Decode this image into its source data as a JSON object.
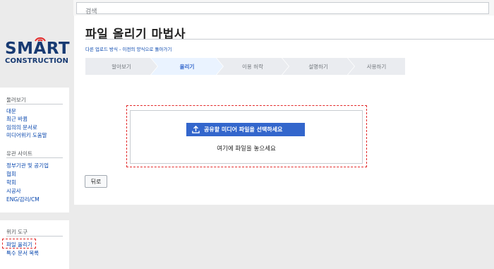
{
  "search": {
    "placeholder": "검색"
  },
  "logo": {
    "line1": "SMART",
    "line2": "CONSTRUCTION"
  },
  "sidebar": {
    "browse": {
      "heading": "둘러보기",
      "items": [
        "대문",
        "최근 바뀜",
        "임의의 문서로",
        "미디어위키 도움말"
      ]
    },
    "related": {
      "heading": "유관 사이트",
      "items": [
        "정부기관 및 공기업",
        "협회",
        "학회",
        "시공사",
        "ENG/감리/CM"
      ]
    },
    "tools": {
      "heading": "위키 도구",
      "items": [
        "파일 올리기",
        "특수 문서 목록"
      ]
    }
  },
  "page": {
    "title": "파일 올리기 마법사",
    "alt_link": "다른 업로드 방식 - 이전의 양식으로 돌아가기"
  },
  "steps": [
    {
      "label": "알아보기",
      "active": false
    },
    {
      "label": "올리기",
      "active": true
    },
    {
      "label": "이용 허락",
      "active": false
    },
    {
      "label": "설명하기",
      "active": false
    },
    {
      "label": "사용하기",
      "active": false
    }
  ],
  "upload": {
    "button_label": "공유할 미디어 파일을 선택하세요",
    "drop_hint": "여기에 파일을 놓으세요"
  },
  "back_button": "뒤로",
  "colors": {
    "accent": "#3366cc",
    "highlight": "#e32b2b",
    "logo": "#173a72"
  }
}
